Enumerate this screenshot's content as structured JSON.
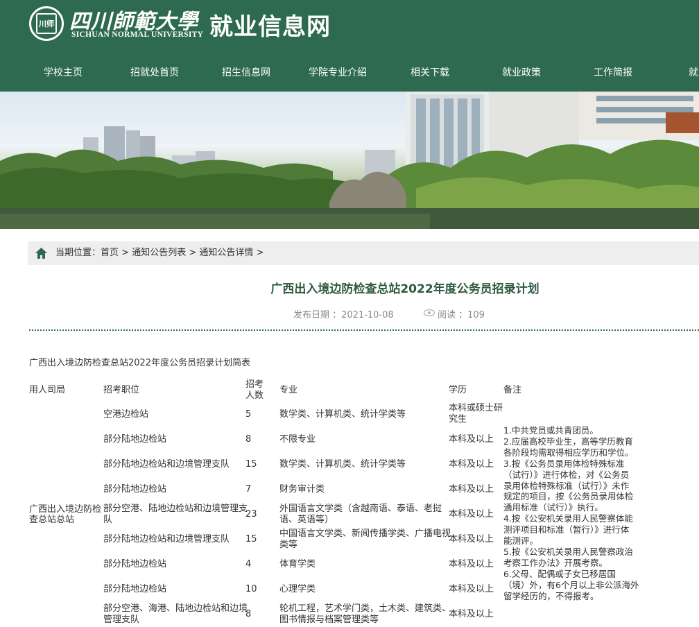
{
  "header": {
    "logo_cn": "四川師範大學",
    "logo_seal_text": "川师",
    "logo_en": "SICHUAN NORMAL UNIVERSITY",
    "site_title": "就业信息网"
  },
  "nav": {
    "items": [
      "学校主页",
      "招就处首页",
      "招生信息网",
      "学院专业介绍",
      "相关下载",
      "就业政策",
      "工作简报",
      "就"
    ]
  },
  "breadcrumb": {
    "label": "当期位置：",
    "home": "首页",
    "list": "通知公告列表",
    "detail": "通知公告详情",
    "sep": ">"
  },
  "article": {
    "title": "广西出入境边防检查总站2022年度公务员招录计划",
    "date_label": "发布日期 ：2021-10-08",
    "views_label": "阅读 ：109",
    "intro": "广西出入境边防检查总站2022年度公务员招录计划简表"
  },
  "table": {
    "headers": {
      "employer": "用人司局",
      "position": "招考职位",
      "count_line1": "招考",
      "count_line2": "人数",
      "major": "专业",
      "education": "学历",
      "remarks": "备注"
    },
    "employer": [
      "广西出入境边防检",
      "查总站总站"
    ],
    "rows": [
      {
        "position": [
          "空港边检站"
        ],
        "count": "5",
        "major": [
          "数学类、计算机类、统计学类等"
        ],
        "education": [
          "本科或硕士研",
          "究生"
        ]
      },
      {
        "position": [
          "部分陆地边检站"
        ],
        "count": "8",
        "major": [
          "不限专业"
        ],
        "education": [
          "本科及以上"
        ]
      },
      {
        "position": [
          "部分陆地边检站和边境管理支队"
        ],
        "count": "15",
        "major": [
          "数学类、计算机类、统计学类等"
        ],
        "education": [
          "本科及以上"
        ]
      },
      {
        "position": [
          "部分陆地边检站"
        ],
        "count": "7",
        "major": [
          "财务审计类"
        ],
        "education": [
          "本科及以上"
        ]
      },
      {
        "position": [
          "部分空港、陆地边检站和边境管理支",
          "队"
        ],
        "count": "23",
        "major": [
          "外国语言文学类（含越南语、泰语、老挝",
          "语、英语等）"
        ],
        "education": [
          "本科及以上"
        ]
      },
      {
        "position": [
          "部分陆地边检站和边境管理支队"
        ],
        "count": "15",
        "major": [
          "中国语言文学类、新闻传播学类、广播电视",
          "类等"
        ],
        "education": [
          "本科及以上"
        ]
      },
      {
        "position": [
          "部分陆地边检站"
        ],
        "count": "4",
        "major": [
          "体育学类"
        ],
        "education": [
          "本科及以上"
        ]
      },
      {
        "position": [
          "部分陆地边检站"
        ],
        "count": "10",
        "major": [
          "心理学类"
        ],
        "education": [
          "本科及以上"
        ]
      },
      {
        "position": [
          "部分空港、海港、陆地边检站和边境",
          "管理支队"
        ],
        "count": "8",
        "major": [
          "轮机工程，艺术学门类，土木类、建筑类、",
          "图书情报与档案管理类等"
        ],
        "education": [
          "本科及以上"
        ]
      }
    ],
    "remarks": [
      "1.中共党员或共青团员。",
      "2.应届高校毕业生，高等学历教育",
      "各阶段均需取得相应学历和学位。",
      "3.按《公务员录用体检特殊标准",
      "（试行）》进行体检，对《公务员",
      "录用体检特殊标准（试行）》未作",
      "规定的项目，按《公务员录用体检",
      "通用标准（试行）》执行。",
      "4.按《公安机关录用人民警察体能",
      "测评项目和标准（暂行）》进行体",
      "能测评。",
      "5.按《公安机关录用人民警察政治",
      "考察工作办法》开展考察。",
      "6.父母、配偶或子女已移居国",
      "（境）外，有6个月以上非公派海外",
      "留学经历的，不得报考。"
    ]
  },
  "colors": {
    "header_green": "#2d6a4f",
    "title_green": "#2d5a3f",
    "breadcrumb_bg": "#eeeeee"
  },
  "icons": {
    "home": "home-icon",
    "views": "eye-icon",
    "logo": "university-seal-icon"
  }
}
